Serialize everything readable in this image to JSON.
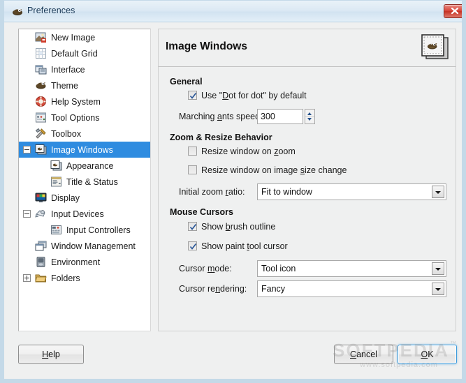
{
  "window": {
    "title": "Preferences",
    "icon": "gimp-wilber-icon",
    "close_label": "x",
    "accent_selection": "#2f8ce0",
    "titlebar_color": "#d8e8f4"
  },
  "sidebar": {
    "items": [
      {
        "label": "New Image",
        "icon": "new-image-icon",
        "indent": 0,
        "expander": "none",
        "selected": false
      },
      {
        "label": "Default Grid",
        "icon": "default-grid-icon",
        "indent": 0,
        "expander": "none",
        "selected": false
      },
      {
        "label": "Interface",
        "icon": "interface-icon",
        "indent": 0,
        "expander": "none",
        "selected": false
      },
      {
        "label": "Theme",
        "icon": "theme-icon",
        "indent": 0,
        "expander": "none",
        "selected": false
      },
      {
        "label": "Help System",
        "icon": "help-system-icon",
        "indent": 0,
        "expander": "none",
        "selected": false
      },
      {
        "label": "Tool Options",
        "icon": "tool-options-icon",
        "indent": 0,
        "expander": "none",
        "selected": false
      },
      {
        "label": "Toolbox",
        "icon": "toolbox-icon",
        "indent": 0,
        "expander": "none",
        "selected": false
      },
      {
        "label": "Image Windows",
        "icon": "image-windows-icon",
        "indent": 0,
        "expander": "minus",
        "selected": true
      },
      {
        "label": "Appearance",
        "icon": "appearance-icon",
        "indent": 1,
        "expander": "none",
        "selected": false
      },
      {
        "label": "Title & Status",
        "icon": "title-status-icon",
        "indent": 1,
        "expander": "none",
        "selected": false
      },
      {
        "label": "Display",
        "icon": "display-icon",
        "indent": 0,
        "expander": "none",
        "selected": false
      },
      {
        "label": "Input Devices",
        "icon": "input-devices-icon",
        "indent": 0,
        "expander": "minus",
        "selected": false
      },
      {
        "label": "Input Controllers",
        "icon": "input-controllers-icon",
        "indent": 1,
        "expander": "none",
        "selected": false
      },
      {
        "label": "Window Management",
        "icon": "window-management-icon",
        "indent": 0,
        "expander": "none",
        "selected": false
      },
      {
        "label": "Environment",
        "icon": "environment-icon",
        "indent": 0,
        "expander": "none",
        "selected": false
      },
      {
        "label": "Folders",
        "icon": "folders-icon",
        "indent": 0,
        "expander": "plus",
        "selected": false
      }
    ]
  },
  "panel": {
    "title": "Image Windows",
    "header_icon": "image-windows-preview-icon",
    "sections": {
      "general": {
        "heading": "General",
        "dot_for_dot": {
          "label_pre": "Use \"",
          "label_mnemonic": "D",
          "label_post": "ot for dot\" by default",
          "checked": true
        },
        "marching_ants": {
          "label_pre": "Marching ",
          "label_mnemonic": "a",
          "label_post": "nts speed:",
          "value": "300"
        }
      },
      "zoom_resize": {
        "heading": "Zoom & Resize Behavior",
        "resize_on_zoom": {
          "label_pre": "Resize window on ",
          "label_mnemonic": "z",
          "label_post": "oom",
          "checked": false
        },
        "resize_on_image_size": {
          "label_pre": "Resize window on image ",
          "label_mnemonic": "s",
          "label_post": "ize change",
          "checked": false
        },
        "initial_zoom_ratio": {
          "label_pre": "Initial zoom ",
          "label_mnemonic": "r",
          "label_post": "atio:",
          "value": "Fit to window"
        }
      },
      "mouse_cursors": {
        "heading": "Mouse Cursors",
        "show_brush_outline": {
          "label_pre": "Show ",
          "label_mnemonic": "b",
          "label_post": "rush outline",
          "checked": true
        },
        "show_paint_tool_cursor": {
          "label_pre": "Show paint ",
          "label_mnemonic": "t",
          "label_post": "ool cursor",
          "checked": true
        },
        "cursor_mode": {
          "label_pre": "Cursor ",
          "label_mnemonic": "m",
          "label_post": "ode:",
          "value": "Tool icon"
        },
        "cursor_rendering": {
          "label_pre": "Cursor re",
          "label_mnemonic": "n",
          "label_post": "dering:",
          "value": "Fancy"
        }
      }
    }
  },
  "buttons": {
    "help": {
      "pre": "",
      "mnemonic": "H",
      "post": "elp"
    },
    "cancel": {
      "pre": "",
      "mnemonic": "C",
      "post": "ancel"
    },
    "ok": {
      "pre": "",
      "mnemonic": "O",
      "post": "K",
      "is_default": true
    }
  },
  "watermark": {
    "main": "SOFTPEDIA",
    "tm": "™",
    "sub": "www.softpedia.com"
  }
}
